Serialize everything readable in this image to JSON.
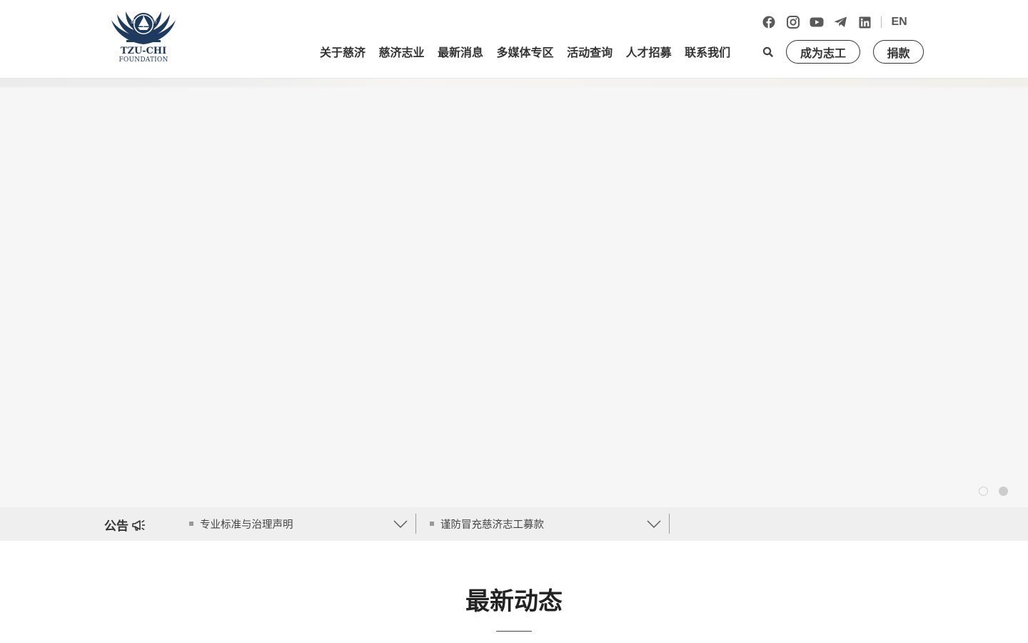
{
  "brand": {
    "logo_line1": "TZU-CHI",
    "logo_line2": "FOUNDATION",
    "logo_color": "#1e3a5f"
  },
  "social": {
    "icons": [
      "facebook-icon",
      "instagram-icon",
      "youtube-icon",
      "telegram-icon",
      "linkedin-icon"
    ],
    "language": "EN"
  },
  "nav": {
    "items": [
      {
        "label": "关于慈济"
      },
      {
        "label": "慈济志业"
      },
      {
        "label": "最新消息"
      },
      {
        "label": "多媒体专区"
      },
      {
        "label": "活动查询"
      },
      {
        "label": "人才招募"
      },
      {
        "label": "联系我们"
      }
    ],
    "search_icon": "search-icon",
    "volunteer_label": "成为志工",
    "donate_label": "捐款"
  },
  "hero": {
    "slides_count": 2,
    "active_slide": 2
  },
  "notice": {
    "label": "公告",
    "label_icon": "megaphone-icon",
    "items": [
      {
        "text": "专业标准与治理声明"
      },
      {
        "text": "谨防冒充慈济志工募款"
      }
    ]
  },
  "section": {
    "title": "最新动态"
  }
}
